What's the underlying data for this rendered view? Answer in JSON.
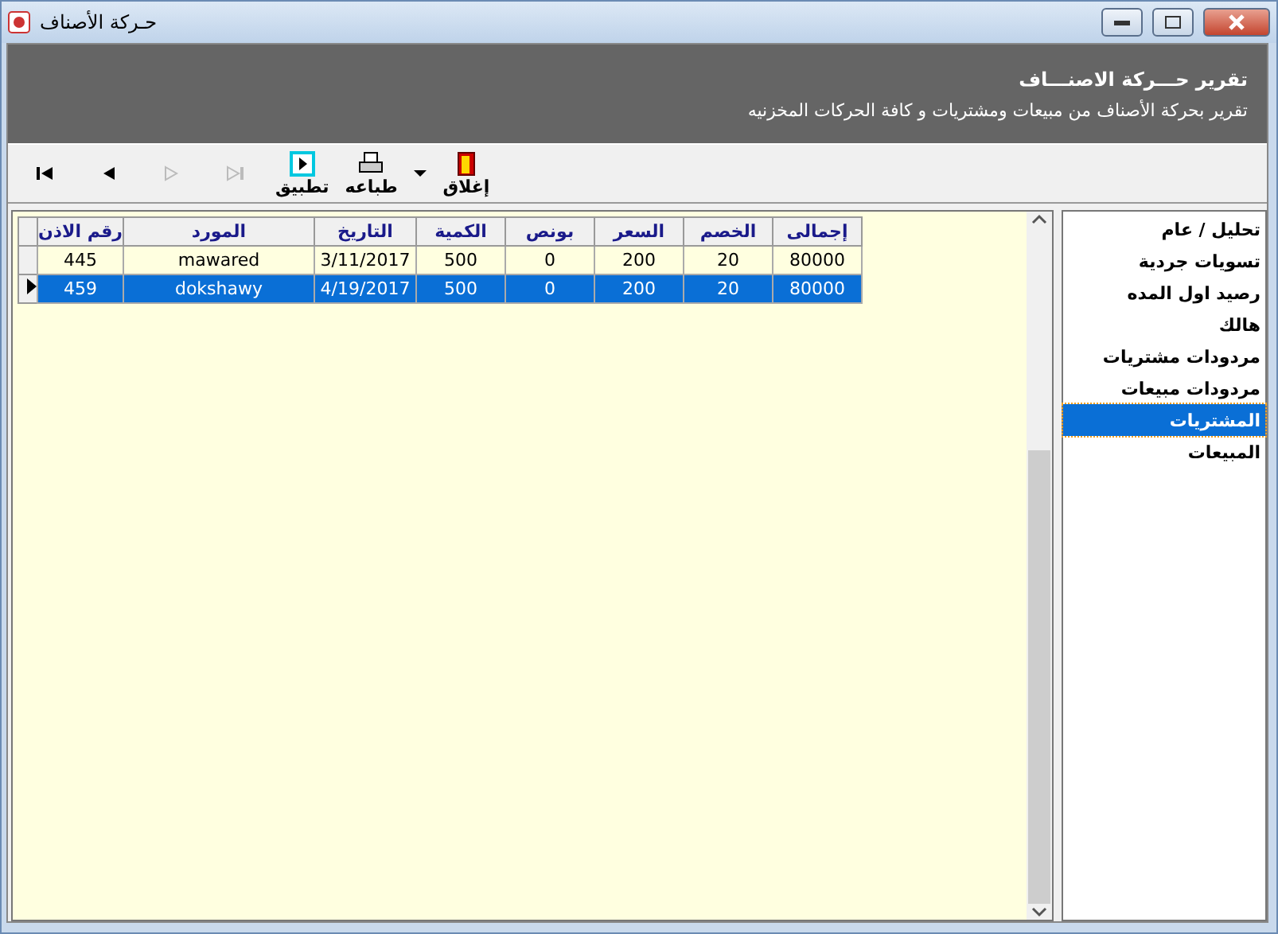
{
  "window": {
    "title": "حـركة الأصناف"
  },
  "header": {
    "title": "تقرير حـــركة الاصنـــاف",
    "subtitle": "تقرير بحركة الأصناف من مبيعات ومشتريات و كافة الحركات المخزنيه"
  },
  "toolbar": [
    {
      "kind": "close",
      "label": "إغلاق",
      "disabled": false
    },
    {
      "kind": "dropdown",
      "disabled": false
    },
    {
      "kind": "print",
      "label": "طباعه",
      "disabled": false
    },
    {
      "kind": "apply",
      "label": "تطبيق",
      "disabled": false
    },
    {
      "kind": "last",
      "disabled": true
    },
    {
      "kind": "next",
      "disabled": true
    },
    {
      "kind": "prev",
      "disabled": false
    },
    {
      "kind": "first",
      "disabled": false
    }
  ],
  "table": {
    "columns": [
      "إجمالى",
      "الخصم",
      "السعر",
      "بونص",
      "الكمية",
      "التاريخ",
      "المورد",
      "رقم الاذن"
    ],
    "rows": [
      {
        "selected": false,
        "cells": [
          "80000",
          "20",
          "200",
          "0",
          "500",
          "3/11/2017",
          "mawared",
          "445"
        ]
      },
      {
        "selected": true,
        "cells": [
          "80000",
          "20",
          "200",
          "0",
          "500",
          "4/19/2017",
          "dokshawy",
          "459"
        ]
      }
    ]
  },
  "sidebar": {
    "items": [
      {
        "label": "تحليل / عام",
        "selected": false
      },
      {
        "label": "تسويات جردية",
        "selected": false
      },
      {
        "label": "رصيد اول المده",
        "selected": false
      },
      {
        "label": "هالك",
        "selected": false
      },
      {
        "label": "مردودات مشتريات",
        "selected": false
      },
      {
        "label": "مردودات مبيعات",
        "selected": false
      },
      {
        "label": "المشتريات",
        "selected": true
      },
      {
        "label": "المبيعات",
        "selected": false
      }
    ]
  }
}
